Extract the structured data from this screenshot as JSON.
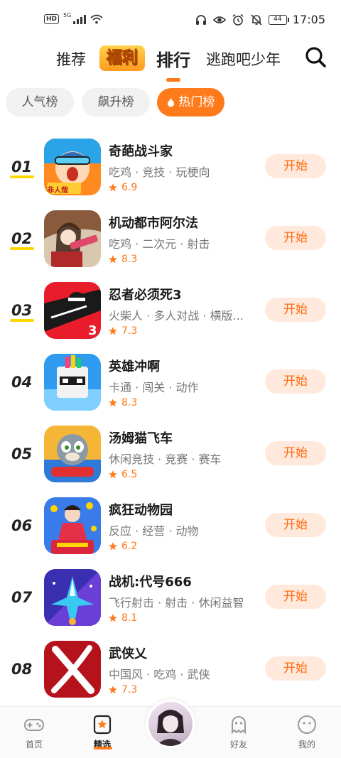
{
  "status_bar": {
    "left_badge": "HD",
    "signal_label": "5G",
    "battery": "44",
    "time": "17:05"
  },
  "top_nav": {
    "tabs": [
      "推荐",
      "福利",
      "排行",
      "逃跑吧少年"
    ],
    "active_tab": "排行"
  },
  "chips": [
    "人气榜",
    "飙升榜",
    "热门榜"
  ],
  "active_chip": "热门榜",
  "ranking": [
    {
      "rank": "01",
      "name": "奇葩战斗家",
      "tags": "吃鸡 · 竞技 · 玩梗向",
      "rating": "6.9",
      "button": "开始"
    },
    {
      "rank": "02",
      "name": "机动都市阿尔法",
      "tags": "吃鸡 · 二次元 · 射击",
      "rating": "8.3",
      "button": "开始"
    },
    {
      "rank": "03",
      "name": "忍者必须死3",
      "tags": "火柴人 · 多人对战 · 横版...",
      "rating": "7.3",
      "button": "开始"
    },
    {
      "rank": "04",
      "name": "英雄冲啊",
      "tags": "卡通 · 闯关 · 动作",
      "rating": "8.3",
      "button": "开始"
    },
    {
      "rank": "05",
      "name": "汤姆猫飞车",
      "tags": "休闲竞技 · 竞赛 · 赛车",
      "rating": "6.5",
      "button": "开始"
    },
    {
      "rank": "06",
      "name": "疯狂动物园",
      "tags": "反应 · 经营 · 动物",
      "rating": "6.2",
      "button": "开始"
    },
    {
      "rank": "07",
      "name": "战机:代号666",
      "tags": "飞行射击 · 射击 · 休闲益智",
      "rating": "8.1",
      "button": "开始"
    },
    {
      "rank": "08",
      "name": "武侠乂",
      "tags": "中国风 · 吃鸡 · 武侠",
      "rating": "7.3",
      "button": "开始"
    }
  ],
  "icon_badge_text": "非人哉",
  "bottom_nav": {
    "items": [
      "首页",
      "精选",
      "好友",
      "我的"
    ],
    "active": "精选"
  },
  "colors": {
    "accent": "#ff7a1a",
    "button_bg": "#ffe9dc",
    "rank_underline": "#ffd700"
  }
}
